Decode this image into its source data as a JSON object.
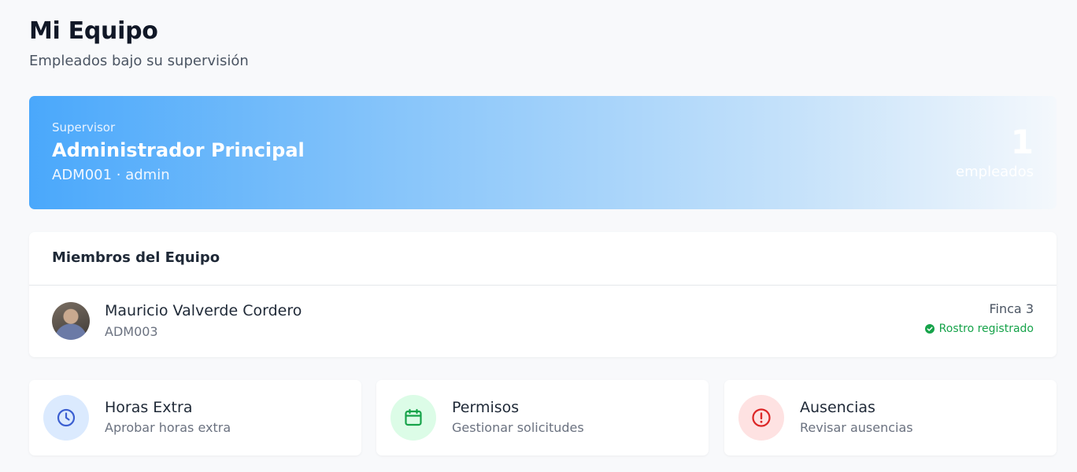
{
  "header": {
    "title": "Mi Equipo",
    "subtitle": "Empleados bajo su supervisión"
  },
  "supervisor": {
    "label": "Supervisor",
    "name": "Administrador Principal",
    "code_line": "ADM001 · admin",
    "count": "1",
    "count_label": "empleados"
  },
  "members": {
    "title": "Miembros del Equipo",
    "items": [
      {
        "name": "Mauricio Valverde Cordero",
        "code": "ADM003",
        "location": "Finca 3",
        "status": "Rostro registrado"
      }
    ]
  },
  "actions": [
    {
      "title": "Horas Extra",
      "description": "Aprobar horas extra",
      "icon": "clock-icon",
      "color": "#3b6fd8",
      "bg": "#dbeafe"
    },
    {
      "title": "Permisos",
      "description": "Gestionar solicitudes",
      "icon": "calendar-icon",
      "color": "#16a34a",
      "bg": "#dcfce7"
    },
    {
      "title": "Ausencias",
      "description": "Revisar ausencias",
      "icon": "alert-circle-icon",
      "color": "#dc2626",
      "bg": "#fee2e2"
    }
  ],
  "colors": {
    "accent": "#4aa8fb",
    "success": "#16a34a"
  }
}
